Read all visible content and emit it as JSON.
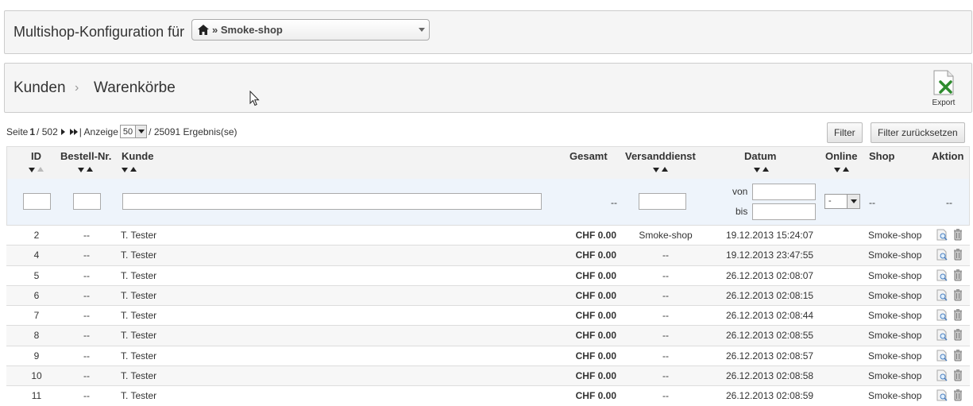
{
  "multishop": {
    "title": "Multishop-Konfiguration für",
    "selected_shop": "» Smoke-shop"
  },
  "breadcrumb": {
    "level1": "Kunden",
    "separator": "›",
    "level2": "Warenkörbe"
  },
  "toolbar": {
    "export_label": "Export"
  },
  "pagination": {
    "page_prefix": "Seite",
    "current_page": "1",
    "total_pages": "/ 502",
    "display_label": "| Anzeige",
    "per_page": "50",
    "results": "/ 25091 Ergebnis(se)"
  },
  "buttons": {
    "filter": "Filter",
    "reset": "Filter zurücksetzen"
  },
  "columns": {
    "id": "ID",
    "order_no": "Bestell-Nr.",
    "customer": "Kunde",
    "total": "Gesamt",
    "carrier": "Versanddienst",
    "date": "Datum",
    "online": "Online",
    "shop": "Shop",
    "action": "Aktion"
  },
  "filters": {
    "total_placeholder": "--",
    "date_from_label": "von",
    "date_to_label": "bis",
    "online_value": "-",
    "shop_placeholder": "--",
    "action_placeholder": "--"
  },
  "rows": [
    {
      "id": "2",
      "order_no": "--",
      "customer": "T. Tester",
      "total": "CHF 0.00",
      "carrier": "Smoke-shop",
      "date": "19.12.2013 15:24:07",
      "shop": "Smoke-shop"
    },
    {
      "id": "4",
      "order_no": "--",
      "customer": "T. Tester",
      "total": "CHF 0.00",
      "carrier": "--",
      "date": "19.12.2013 23:47:55",
      "shop": "Smoke-shop"
    },
    {
      "id": "5",
      "order_no": "--",
      "customer": "T. Tester",
      "total": "CHF 0.00",
      "carrier": "--",
      "date": "26.12.2013 02:08:07",
      "shop": "Smoke-shop"
    },
    {
      "id": "6",
      "order_no": "--",
      "customer": "T. Tester",
      "total": "CHF 0.00",
      "carrier": "--",
      "date": "26.12.2013 02:08:15",
      "shop": "Smoke-shop"
    },
    {
      "id": "7",
      "order_no": "--",
      "customer": "T. Tester",
      "total": "CHF 0.00",
      "carrier": "--",
      "date": "26.12.2013 02:08:44",
      "shop": "Smoke-shop"
    },
    {
      "id": "8",
      "order_no": "--",
      "customer": "T. Tester",
      "total": "CHF 0.00",
      "carrier": "--",
      "date": "26.12.2013 02:08:55",
      "shop": "Smoke-shop"
    },
    {
      "id": "9",
      "order_no": "--",
      "customer": "T. Tester",
      "total": "CHF 0.00",
      "carrier": "--",
      "date": "26.12.2013 02:08:57",
      "shop": "Smoke-shop"
    },
    {
      "id": "10",
      "order_no": "--",
      "customer": "T. Tester",
      "total": "CHF 0.00",
      "carrier": "--",
      "date": "26.12.2013 02:08:58",
      "shop": "Smoke-shop"
    },
    {
      "id": "11",
      "order_no": "--",
      "customer": "T. Tester",
      "total": "CHF 0.00",
      "carrier": "--",
      "date": "26.12.2013 02:08:59",
      "shop": "Smoke-shop"
    }
  ]
}
